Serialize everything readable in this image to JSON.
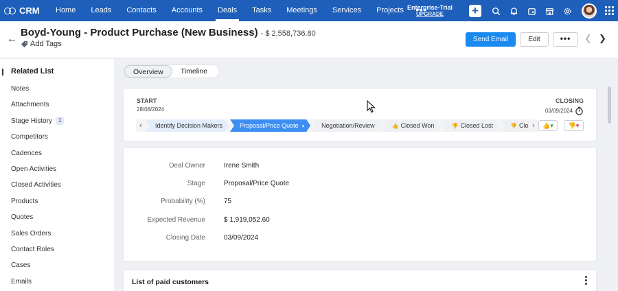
{
  "nav": {
    "brand": "CRM",
    "tabs": [
      {
        "label": "Home",
        "active": false
      },
      {
        "label": "Leads",
        "active": false
      },
      {
        "label": "Contacts",
        "active": false
      },
      {
        "label": "Accounts",
        "active": false
      },
      {
        "label": "Deals",
        "active": true
      },
      {
        "label": "Tasks",
        "active": false
      },
      {
        "label": "Meetings",
        "active": false
      },
      {
        "label": "Services",
        "active": false
      },
      {
        "label": "Projects",
        "active": false
      }
    ],
    "more": "•••",
    "trial_title": "Enterprise-Trial",
    "trial_link": "UPGRADE",
    "icons": [
      "plus-icon",
      "search-icon",
      "bell-icon",
      "calendar-icon",
      "store-icon",
      "gear-icon",
      "avatar",
      "app-grid-icon"
    ]
  },
  "header": {
    "title": "Boyd-Young - Product Purchase (New Business)",
    "amount": "- $ 2,558,736.80",
    "add_tags": "Add Tags",
    "send_email": "Send Email",
    "edit": "Edit",
    "more": "•••"
  },
  "sidebar": {
    "heading": "Related List",
    "items": [
      {
        "label": "Notes"
      },
      {
        "label": "Attachments"
      },
      {
        "label": "Stage History",
        "badge": "1"
      },
      {
        "label": "Competitors"
      },
      {
        "label": "Cadences"
      },
      {
        "label": "Open Activities"
      },
      {
        "label": "Closed Activities"
      },
      {
        "label": "Products"
      },
      {
        "label": "Quotes"
      },
      {
        "label": "Sales Orders"
      },
      {
        "label": "Contact Roles"
      },
      {
        "label": "Cases"
      },
      {
        "label": "Emails"
      }
    ]
  },
  "view_toggle": {
    "overview": "Overview",
    "timeline": "Timeline",
    "selected": "Overview"
  },
  "stage": {
    "start_label": "START",
    "start_date": "28/08/2024",
    "closing_label": "CLOSING",
    "closing_date": "03/09/2024",
    "stages": [
      {
        "label": "Identify Decision Makers",
        "state": "done"
      },
      {
        "label": "Proposal/Price Quote",
        "state": "current"
      },
      {
        "label": "Negotiation/Review",
        "state": "pending"
      },
      {
        "label": "Closed Won",
        "state": "pending",
        "icon": "thumbs-up-icon"
      },
      {
        "label": "Closed Lost",
        "state": "pending",
        "icon": "thumbs-down-icon"
      },
      {
        "label": "Closed Lo",
        "state": "pending",
        "icon": "thumbs-down-icon"
      }
    ],
    "accent": "#3d8ef2"
  },
  "details": [
    {
      "label": "Deal Owner",
      "value": "Irene Smith"
    },
    {
      "label": "Stage",
      "value": "Proposal/Price Quote"
    },
    {
      "label": "Probability (%)",
      "value": "75"
    },
    {
      "label": "Expected Revenue",
      "value": "$ 1,919,052.60"
    },
    {
      "label": "Closing Date",
      "value": "03/09/2024"
    }
  ],
  "paid_customers": {
    "title": "List of paid customers"
  },
  "colors": {
    "nav_bg": "#1d5fba",
    "primary_button": "#1a8af0",
    "won": "#2aa84a",
    "lost": "#d9344a"
  }
}
